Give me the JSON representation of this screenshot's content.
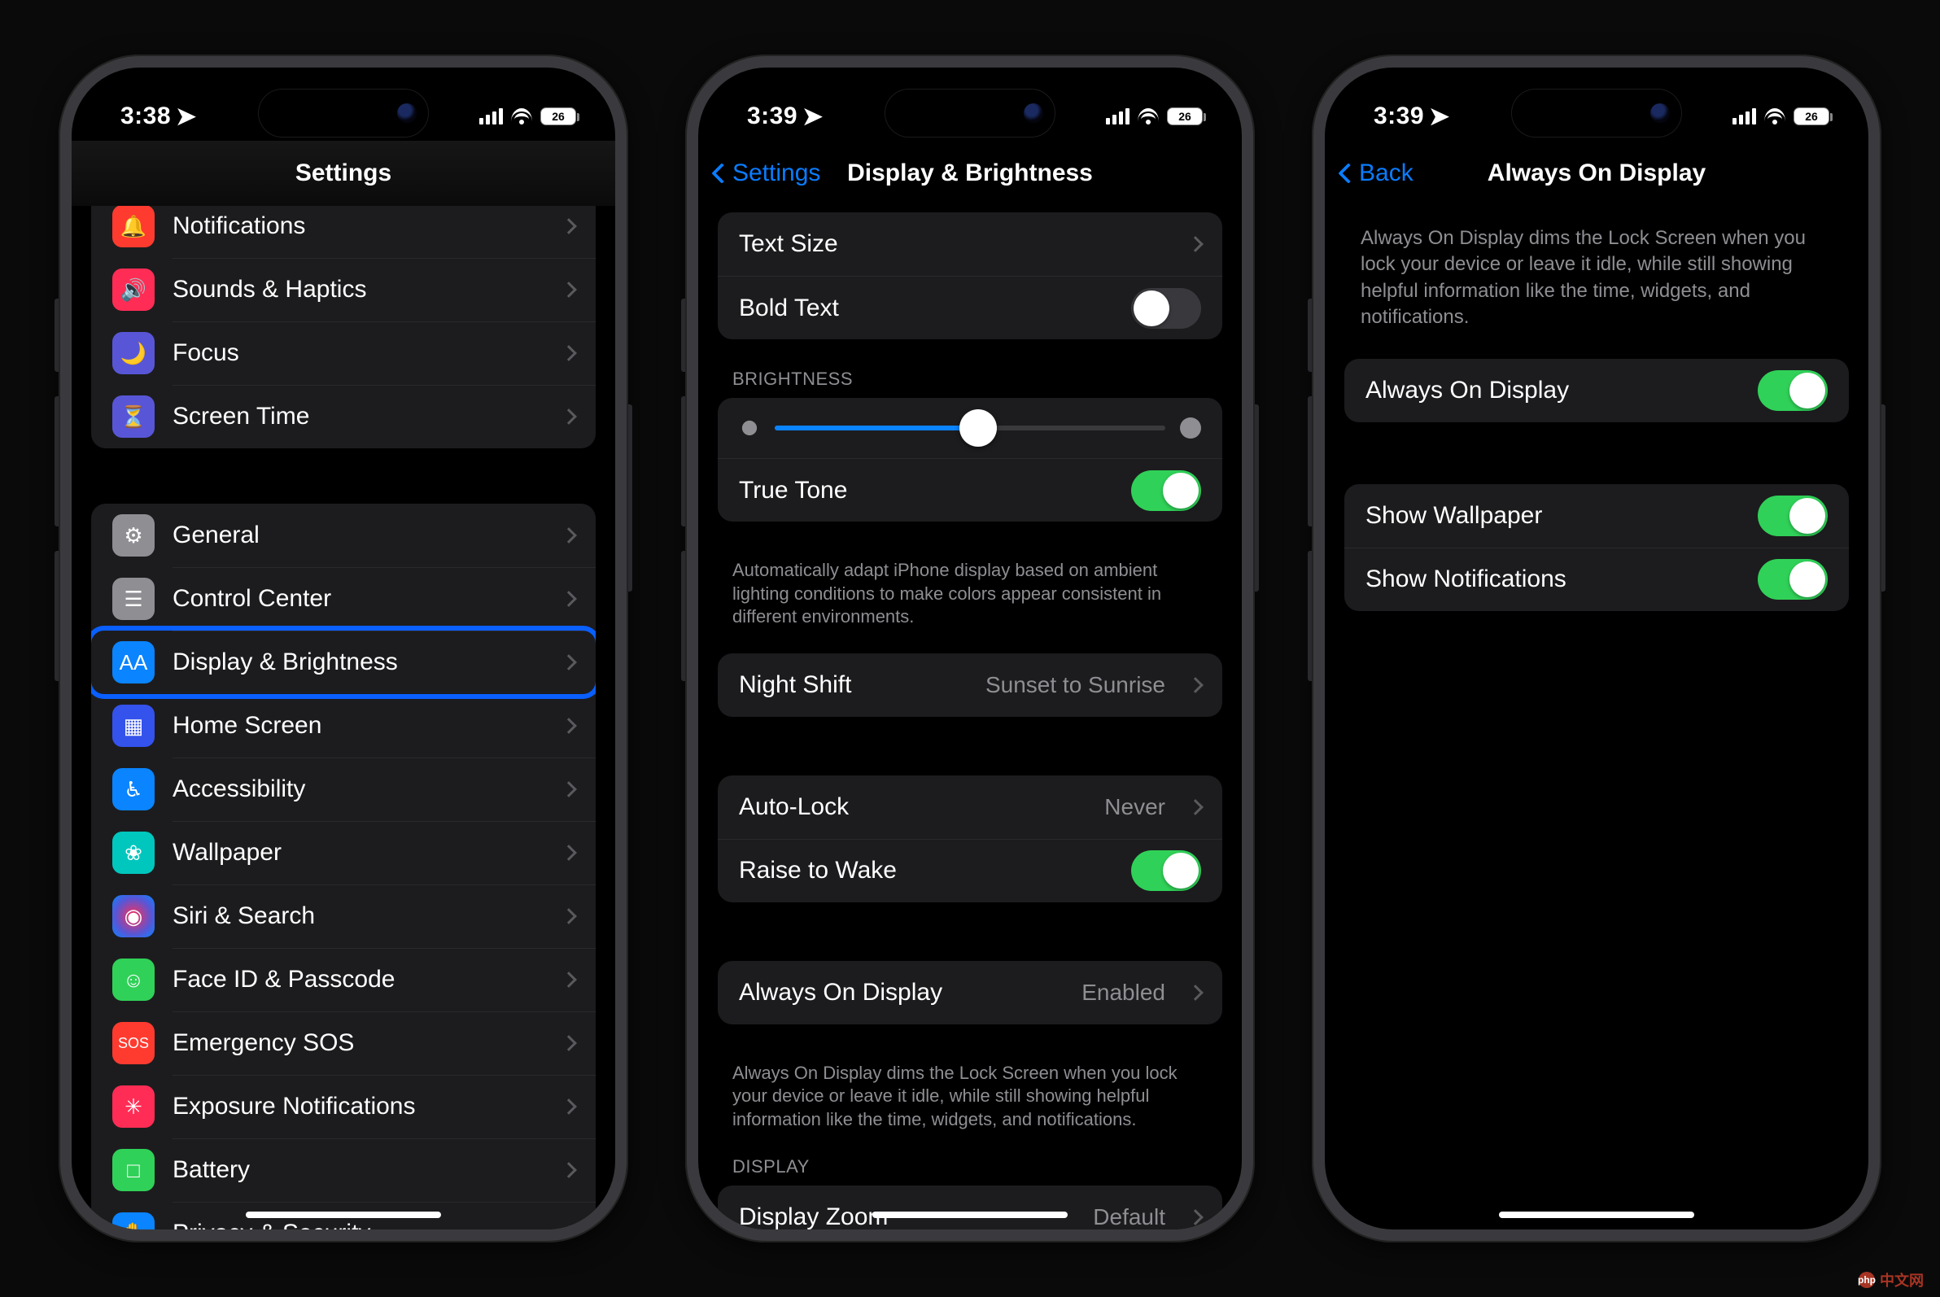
{
  "watermark": "中文网",
  "phone1": {
    "time": "3:38",
    "battery": "26",
    "title": "Settings",
    "rows": [
      {
        "icon": "ic-bell",
        "glyph": "🔔",
        "label": "Notifications"
      },
      {
        "icon": "ic-sound",
        "glyph": "🔊",
        "label": "Sounds & Haptics"
      },
      {
        "icon": "ic-moon",
        "glyph": "🌙",
        "label": "Focus"
      },
      {
        "icon": "ic-hourglass",
        "glyph": "⏳",
        "label": "Screen Time"
      }
    ],
    "rows2": [
      {
        "icon": "ic-gear",
        "glyph": "⚙︎",
        "label": "General"
      },
      {
        "icon": "ic-cc",
        "glyph": "☰",
        "label": "Control Center"
      },
      {
        "icon": "ic-display",
        "glyph": "AA",
        "label": "Display & Brightness",
        "hl": true
      },
      {
        "icon": "ic-home",
        "glyph": "▦",
        "label": "Home Screen"
      },
      {
        "icon": "ic-acc",
        "glyph": "♿︎",
        "label": "Accessibility"
      },
      {
        "icon": "ic-wall",
        "glyph": "❀",
        "label": "Wallpaper"
      },
      {
        "icon": "ic-siri",
        "glyph": "◉",
        "label": "Siri & Search"
      },
      {
        "icon": "ic-face",
        "glyph": "☺︎",
        "label": "Face ID & Passcode"
      },
      {
        "icon": "ic-sos",
        "glyph": "SOS",
        "label": "Emergency SOS"
      },
      {
        "icon": "ic-exposure",
        "glyph": "✳︎",
        "label": "Exposure Notifications"
      },
      {
        "icon": "ic-batt",
        "glyph": "□",
        "label": "Battery"
      },
      {
        "icon": "ic-privacy",
        "glyph": "✋",
        "label": "Privacy & Security"
      }
    ]
  },
  "phone2": {
    "time": "3:39",
    "battery": "26",
    "back": "Settings",
    "title": "Display & Brightness",
    "text_size": "Text Size",
    "bold_text": "Bold Text",
    "brightness_header": "BRIGHTNESS",
    "true_tone": "True Tone",
    "true_tone_footer": "Automatically adapt iPhone display based on ambient lighting conditions to make colors appear consistent in different environments.",
    "night_shift": "Night Shift",
    "night_shift_detail": "Sunset to Sunrise",
    "auto_lock": "Auto-Lock",
    "auto_lock_detail": "Never",
    "raise_to_wake": "Raise to Wake",
    "aod": "Always On Display",
    "aod_detail": "Enabled",
    "aod_footer": "Always On Display dims the Lock Screen when you lock your device or leave it idle, while still showing helpful information like the time, widgets, and notifications.",
    "display_header": "DISPLAY",
    "display_zoom": "Display Zoom",
    "display_zoom_detail": "Default"
  },
  "phone3": {
    "time": "3:39",
    "battery": "26",
    "back": "Back",
    "title": "Always On Display",
    "info": "Always On Display dims the Lock Screen when you lock your device or leave it idle, while still showing helpful information like the time, widgets, and notifications.",
    "aod_toggle": "Always On Display",
    "show_wallpaper": "Show Wallpaper",
    "show_notifications": "Show Notifications"
  }
}
